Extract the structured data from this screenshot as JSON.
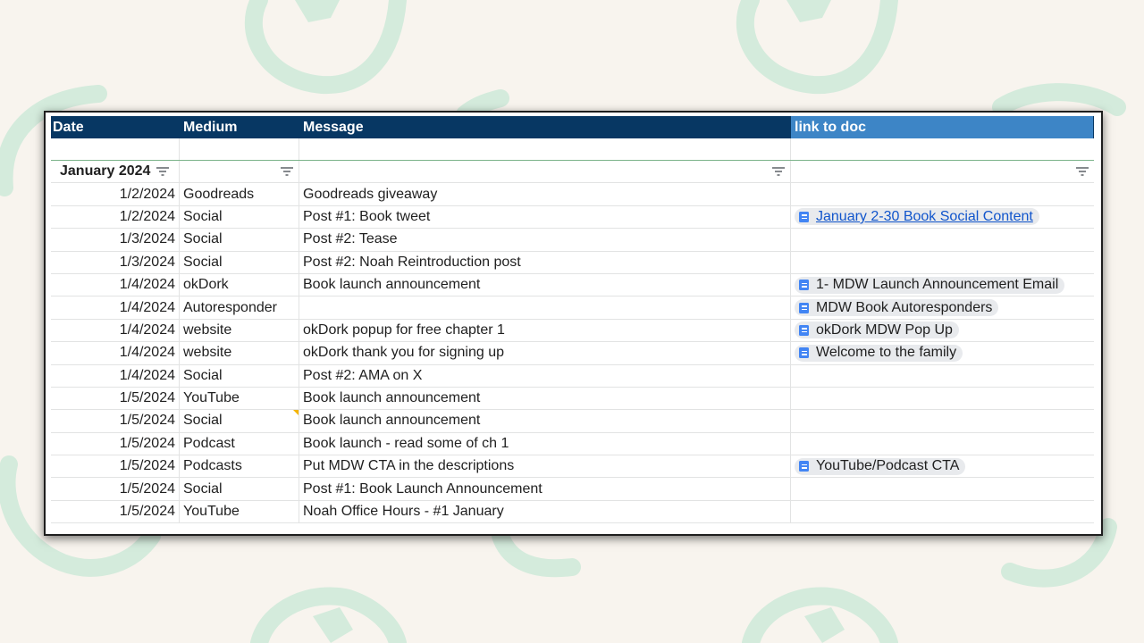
{
  "header": {
    "col1": "Date",
    "col2": "Medium",
    "col3": "Message",
    "col4": "link to doc"
  },
  "group_label": "January 2024",
  "icons": {
    "filter": "filter-icon",
    "doc": "google-doc-icon"
  },
  "colors": {
    "header_dark": "#073763",
    "header_light": "#3d85c6",
    "link": "#1155cc",
    "doc_icon": "#4285f4"
  },
  "rows": [
    {
      "date": "1/2/2024",
      "medium": "Goodreads",
      "message": "Goodreads giveaway",
      "doc": ""
    },
    {
      "date": "1/2/2024",
      "medium": "Social",
      "message": "Post #1: Book tweet",
      "doc": "January 2-30 Book Social Content"
    },
    {
      "date": "1/3/2024",
      "medium": "Social",
      "message": "Post #2: Tease",
      "doc": ""
    },
    {
      "date": "1/3/2024",
      "medium": "Social",
      "message": "Post #2: Noah Reintroduction post",
      "doc": ""
    },
    {
      "date": "1/4/2024",
      "medium": "okDork",
      "message": "Book launch announcement",
      "doc": "1- MDW Launch Announcement Email"
    },
    {
      "date": "1/4/2024",
      "medium": "Autoresponder",
      "message": "",
      "doc": "MDW Book Autoresponders"
    },
    {
      "date": "1/4/2024",
      "medium": "website",
      "message": "okDork popup for free chapter 1",
      "doc": "okDork MDW Pop Up"
    },
    {
      "date": "1/4/2024",
      "medium": "website",
      "message": "okDork thank you for signing up",
      "doc": "Welcome to the family"
    },
    {
      "date": "1/4/2024",
      "medium": "Social",
      "message": "Post #2: AMA on X",
      "doc": ""
    },
    {
      "date": "1/5/2024",
      "medium": "YouTube",
      "message": "Book launch announcement",
      "doc": ""
    },
    {
      "date": "1/5/2024",
      "medium": "Social",
      "message": "Book launch announcement",
      "doc": ""
    },
    {
      "date": "1/5/2024",
      "medium": "Podcast",
      "message": "Book launch - read some of ch 1",
      "doc": ""
    },
    {
      "date": "1/5/2024",
      "medium": "Podcasts",
      "message": "Put MDW CTA in the descriptions",
      "doc": "YouTube/Podcast CTA"
    },
    {
      "date": "1/5/2024",
      "medium": "Social",
      "message": "Post #1: Book Launch Announcement",
      "doc": ""
    },
    {
      "date": "1/5/2024",
      "medium": "YouTube",
      "message": "Noah Office Hours - #1 January",
      "doc": ""
    }
  ]
}
